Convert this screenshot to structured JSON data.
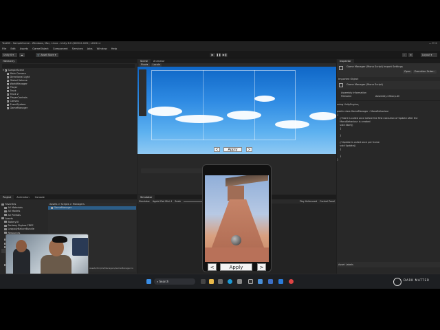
{
  "window": {
    "title": "Test3D - SampleScene - Windows, Mac, Linux - Unity 6.0 (6000.0.40f1) <DX11>"
  },
  "menu": [
    "File",
    "Edit",
    "Assets",
    "GameObject",
    "Component",
    "Services",
    "Jobs",
    "Window",
    "Help"
  ],
  "toolbar": {
    "account": "Unity 6",
    "asset_store": "Asset Store",
    "layout": "Layout"
  },
  "hierarchy": {
    "tab": "Hierarchy",
    "scene": "SampleScene",
    "items": [
      "Main Camera",
      "Directional Light",
      "Global Volume",
      "WorldManager",
      "Player",
      "Track",
      "Track 2",
      "PlayerControls",
      "Canvas",
      "EventSystem",
      "GameManager"
    ]
  },
  "scene": {
    "tabs": [
      "Scene",
      "Animator"
    ],
    "pivot": "Pivot",
    "local": "Local",
    "apply_label": "Apply",
    "prev": "<",
    "next": ">"
  },
  "project": {
    "tabs": [
      "Project",
      "Animation",
      "Console"
    ],
    "tree": [
      "Favorites",
      "All Materials",
      "All Models",
      "All Prefabs",
      "Assets",
      "BakeryUI",
      "Fantasy Skybox FREE",
      "LowpolyNatureBundle",
      "Resources",
      "Skins",
      "Settings",
      "Scenes",
      "Scripts",
      "Managers",
      "Player",
      "Skins",
      "UI/Ui",
      "Settings"
    ],
    "breadcrumb": "Assets > Scripts > Managers",
    "files": [
      "GameManager"
    ],
    "footer": "Assets/Scripts/Managers/GameManager.cs"
  },
  "simulator": {
    "tab": "Simulator",
    "mode": "Simulator",
    "device": "Apple iPad Mini 4",
    "scale_label": "Scale",
    "fit": "Fit to Screen",
    "rotate": "Rotate",
    "safe_area": "Safe Area",
    "play_mode": "Play Unfocused",
    "control": "Control Panel",
    "apply_label": "Apply",
    "prev": "<",
    "next": ">"
  },
  "inspector": {
    "tab": "Inspector",
    "title": "Game Manager (Mono Script) Import Settings",
    "open": "Open",
    "execution_order": "Execution Order...",
    "imported_object": "Imported Object",
    "object_name": "Game Manager (Mono Script)",
    "assembly_info": "Assembly Information",
    "filename_label": "Filename",
    "filename_value": "Assembly-CSharp.dll",
    "code": "using UnityEngine;\n\npublic class GameManager : MonoBehaviour\n{\n    // Start is called once before the first execution of Update after the\n    MonoBehaviour is created\n    void Start()\n    {\n\n    }\n\n    // Update is called once per frame\n    void Update()\n    {\n\n    }\n}",
    "asset_labels": "Asset Labels"
  },
  "taskbar": {
    "search": "Search",
    "brand": "DARK MATTER"
  },
  "colors": {
    "accent_blue": "#2c5d87",
    "unity_bg": "#282828"
  }
}
